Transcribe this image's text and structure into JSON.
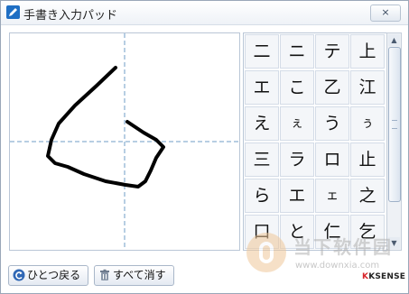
{
  "window": {
    "title": "手書き入力パッド",
    "close_label": "×",
    "accent": "#1f6fc4"
  },
  "pad": {
    "guide_color": "#6f9cc7",
    "stroke_color": "#000000"
  },
  "candidates": [
    "二",
    "ニ",
    "テ",
    "上",
    "エ",
    "こ",
    "乙",
    "江",
    "え",
    "ぇ",
    "う",
    "ぅ",
    "三",
    "ラ",
    "ロ",
    "止",
    "ら",
    "エ",
    "ェ",
    "之",
    "口",
    "と",
    "仁",
    "乞"
  ],
  "scrollbar": {
    "up_icon": "arrow-up-icon",
    "down_icon": "arrow-down-icon"
  },
  "footer": {
    "undo_label": "ひとつ戻る",
    "clear_label": "すべて消す",
    "brand_k": "K",
    "brand_rest": "KSENSE"
  },
  "watermark": {
    "title": "当下软件园",
    "url": "www.downxia.com"
  }
}
